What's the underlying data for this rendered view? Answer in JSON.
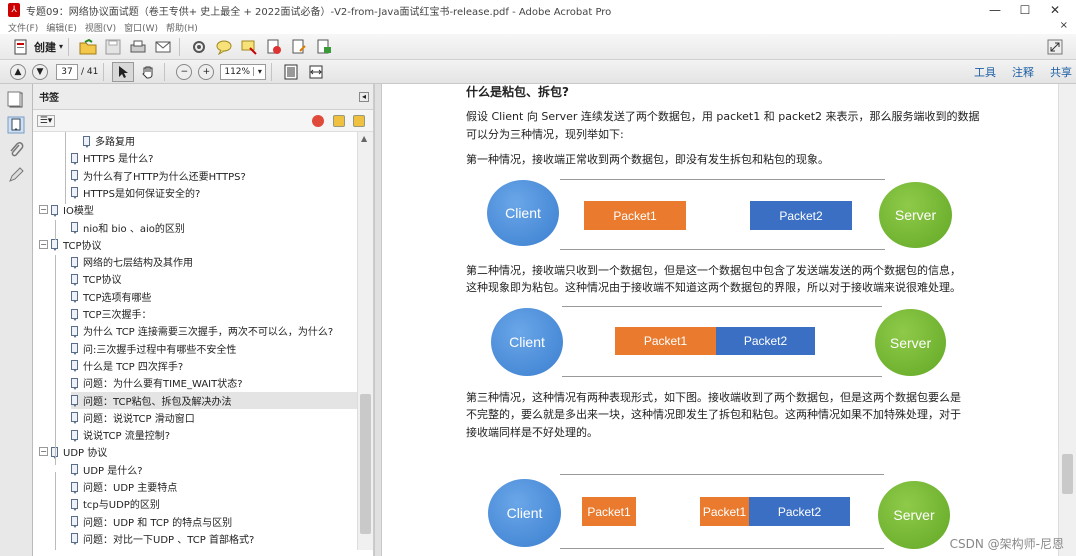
{
  "window": {
    "title": "专题09：网络协议面试题（卷王专供+ 史上最全 + 2022面试必备）-V2-from-Java面试红宝书-release.pdf - Adobe Acrobat Pro",
    "minimize": "—",
    "maximize": "☐",
    "close": "✕"
  },
  "menubar": {
    "items": [
      "文件(F)",
      "编辑(E)",
      "视图(V)",
      "窗口(W)",
      "帮助(H)"
    ],
    "close": "×"
  },
  "toolbar": {
    "create_label": "创建",
    "create_arrow": "▾"
  },
  "nav": {
    "page_current": "37",
    "page_total": "/ 41",
    "zoom": "112%",
    "zoom_arrow": "▾",
    "tools_link": "工具",
    "comment_link": "注释",
    "share_link": "共享"
  },
  "bookmarks": {
    "header": "书签",
    "collapse": "◂",
    "options": "☰▾",
    "items": [
      {
        "label": "多路复用",
        "level": 3
      },
      {
        "label": "HTTPS 是什么?",
        "level": 2
      },
      {
        "label": "为什么有了HTTP为什么还要HTTPS?",
        "level": 2
      },
      {
        "label": "HTTPS是如何保证安全的?",
        "level": 2
      },
      {
        "label": "IO模型",
        "level": 1,
        "expander": "−"
      },
      {
        "label": "nio和 bio 、aio的区别",
        "level": 2
      },
      {
        "label": "TCP协议",
        "level": 1,
        "expander": "−"
      },
      {
        "label": "网络的七层结构及其作用",
        "level": 2
      },
      {
        "label": "TCP协议",
        "level": 2
      },
      {
        "label": "TCP选项有哪些",
        "level": 2
      },
      {
        "label": "TCP三次握手：",
        "level": 2
      },
      {
        "label": "为什么 TCP 连接需要三次握手，两次不可以么，为什么?",
        "level": 2
      },
      {
        "label": "问:三次握手过程中有哪些不安全性",
        "level": 2
      },
      {
        "label": "什么是 TCP 四次挥手?",
        "level": 2
      },
      {
        "label": "问题：为什么要有TIME_WAIT状态?",
        "level": 2
      },
      {
        "label": "问题：TCP粘包、拆包及解决办法",
        "level": 2,
        "selected": true
      },
      {
        "label": "问题：说说TCP 滑动窗口",
        "level": 2
      },
      {
        "label": "说说TCP 流量控制?",
        "level": 2
      },
      {
        "label": "UDP 协议",
        "level": 1,
        "expander": "−"
      },
      {
        "label": "UDP 是什么?",
        "level": 2
      },
      {
        "label": "问题：UDP 主要特点",
        "level": 2
      },
      {
        "label": "tcp与UDP的区别",
        "level": 2
      },
      {
        "label": "问题：UDP 和 TCP 的特点与区别",
        "level": 2
      },
      {
        "label": "问题：对比一下UDP 、TCP 首部格式?",
        "level": 2
      }
    ]
  },
  "document": {
    "heading": "什么是粘包、拆包?",
    "intro_line1": "假设 Client 向 Server 连续发送了两个数据包，用 packet1 和 packet2 来表示，那么服务端收到的数据",
    "intro_line2": "可以分为三种情况，现列举如下:",
    "case1": "第一种情况，接收端正常收到两个数据包，即没有发生拆包和粘包的现象。",
    "case2_line1": "第二种情况，接收端只收到一个数据包，但是这一个数据包中包含了发送端发送的两个数据包的信息，",
    "case2_line2": "这种现象即为粘包。这种情况由于接收端不知道这两个数据包的界限，所以对于接收端来说很难处理。",
    "case3_line1": "第三种情况，这种情况有两种表现形式，如下图。接收端收到了两个数据包，但是这两个数据包要么是",
    "case3_line2": "不完整的，要么就是多出来一块，这种情况即发生了拆包和粘包。这两种情况如果不加特殊处理，对于",
    "case3_line3": "接收端同样是不好处理的。",
    "client": "Client",
    "server": "Server",
    "packet1": "Packet1",
    "packet2": "Packet2",
    "packet1_compact": "Packet1",
    "packet1_fragment": "Packet1",
    "packet1_rest": "Packet1",
    "packet2_full": "Packet2"
  },
  "watermark": "CSDN @架构师-尼恩",
  "colors": {
    "client_blue": "#3b7fd0",
    "server_green": "#62a826",
    "packet_orange": "#ea7a2e",
    "packet_blue": "#3a6fc4",
    "link_blue": "#1e5fa5"
  }
}
